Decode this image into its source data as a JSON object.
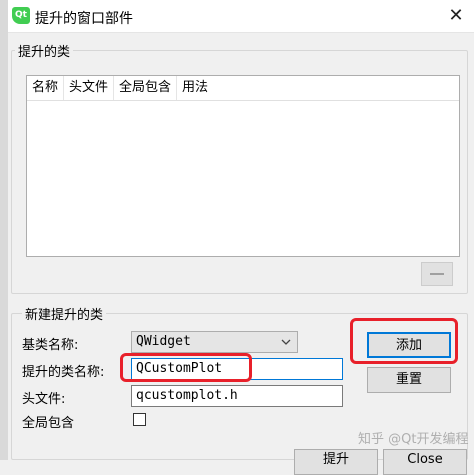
{
  "window": {
    "icon_text": "Qt",
    "title": "提升的窗口部件",
    "close_glyph": "✕"
  },
  "promoted_classes": {
    "title": "提升的类",
    "columns": [
      "名称",
      "头文件",
      "全局包含",
      "用法"
    ]
  },
  "new_promoted": {
    "title": "新建提升的类",
    "base_class_label": "基类名称:",
    "base_class_value": "QWidget",
    "class_name_label": "提升的类名称:",
    "class_name_value": "QCustomPlot",
    "header_label": "头文件:",
    "header_value": "qcustomplot.h",
    "global_include_label": "全局包含",
    "add_label": "添加",
    "reset_label": "重置"
  },
  "footer": {
    "promote_label": "提升",
    "close_label": "Close"
  },
  "watermark": "知乎 @Qt开发编程",
  "colors": {
    "highlight": "#e8202a",
    "focus": "#0078d7",
    "qt_green": "#41cd52"
  }
}
